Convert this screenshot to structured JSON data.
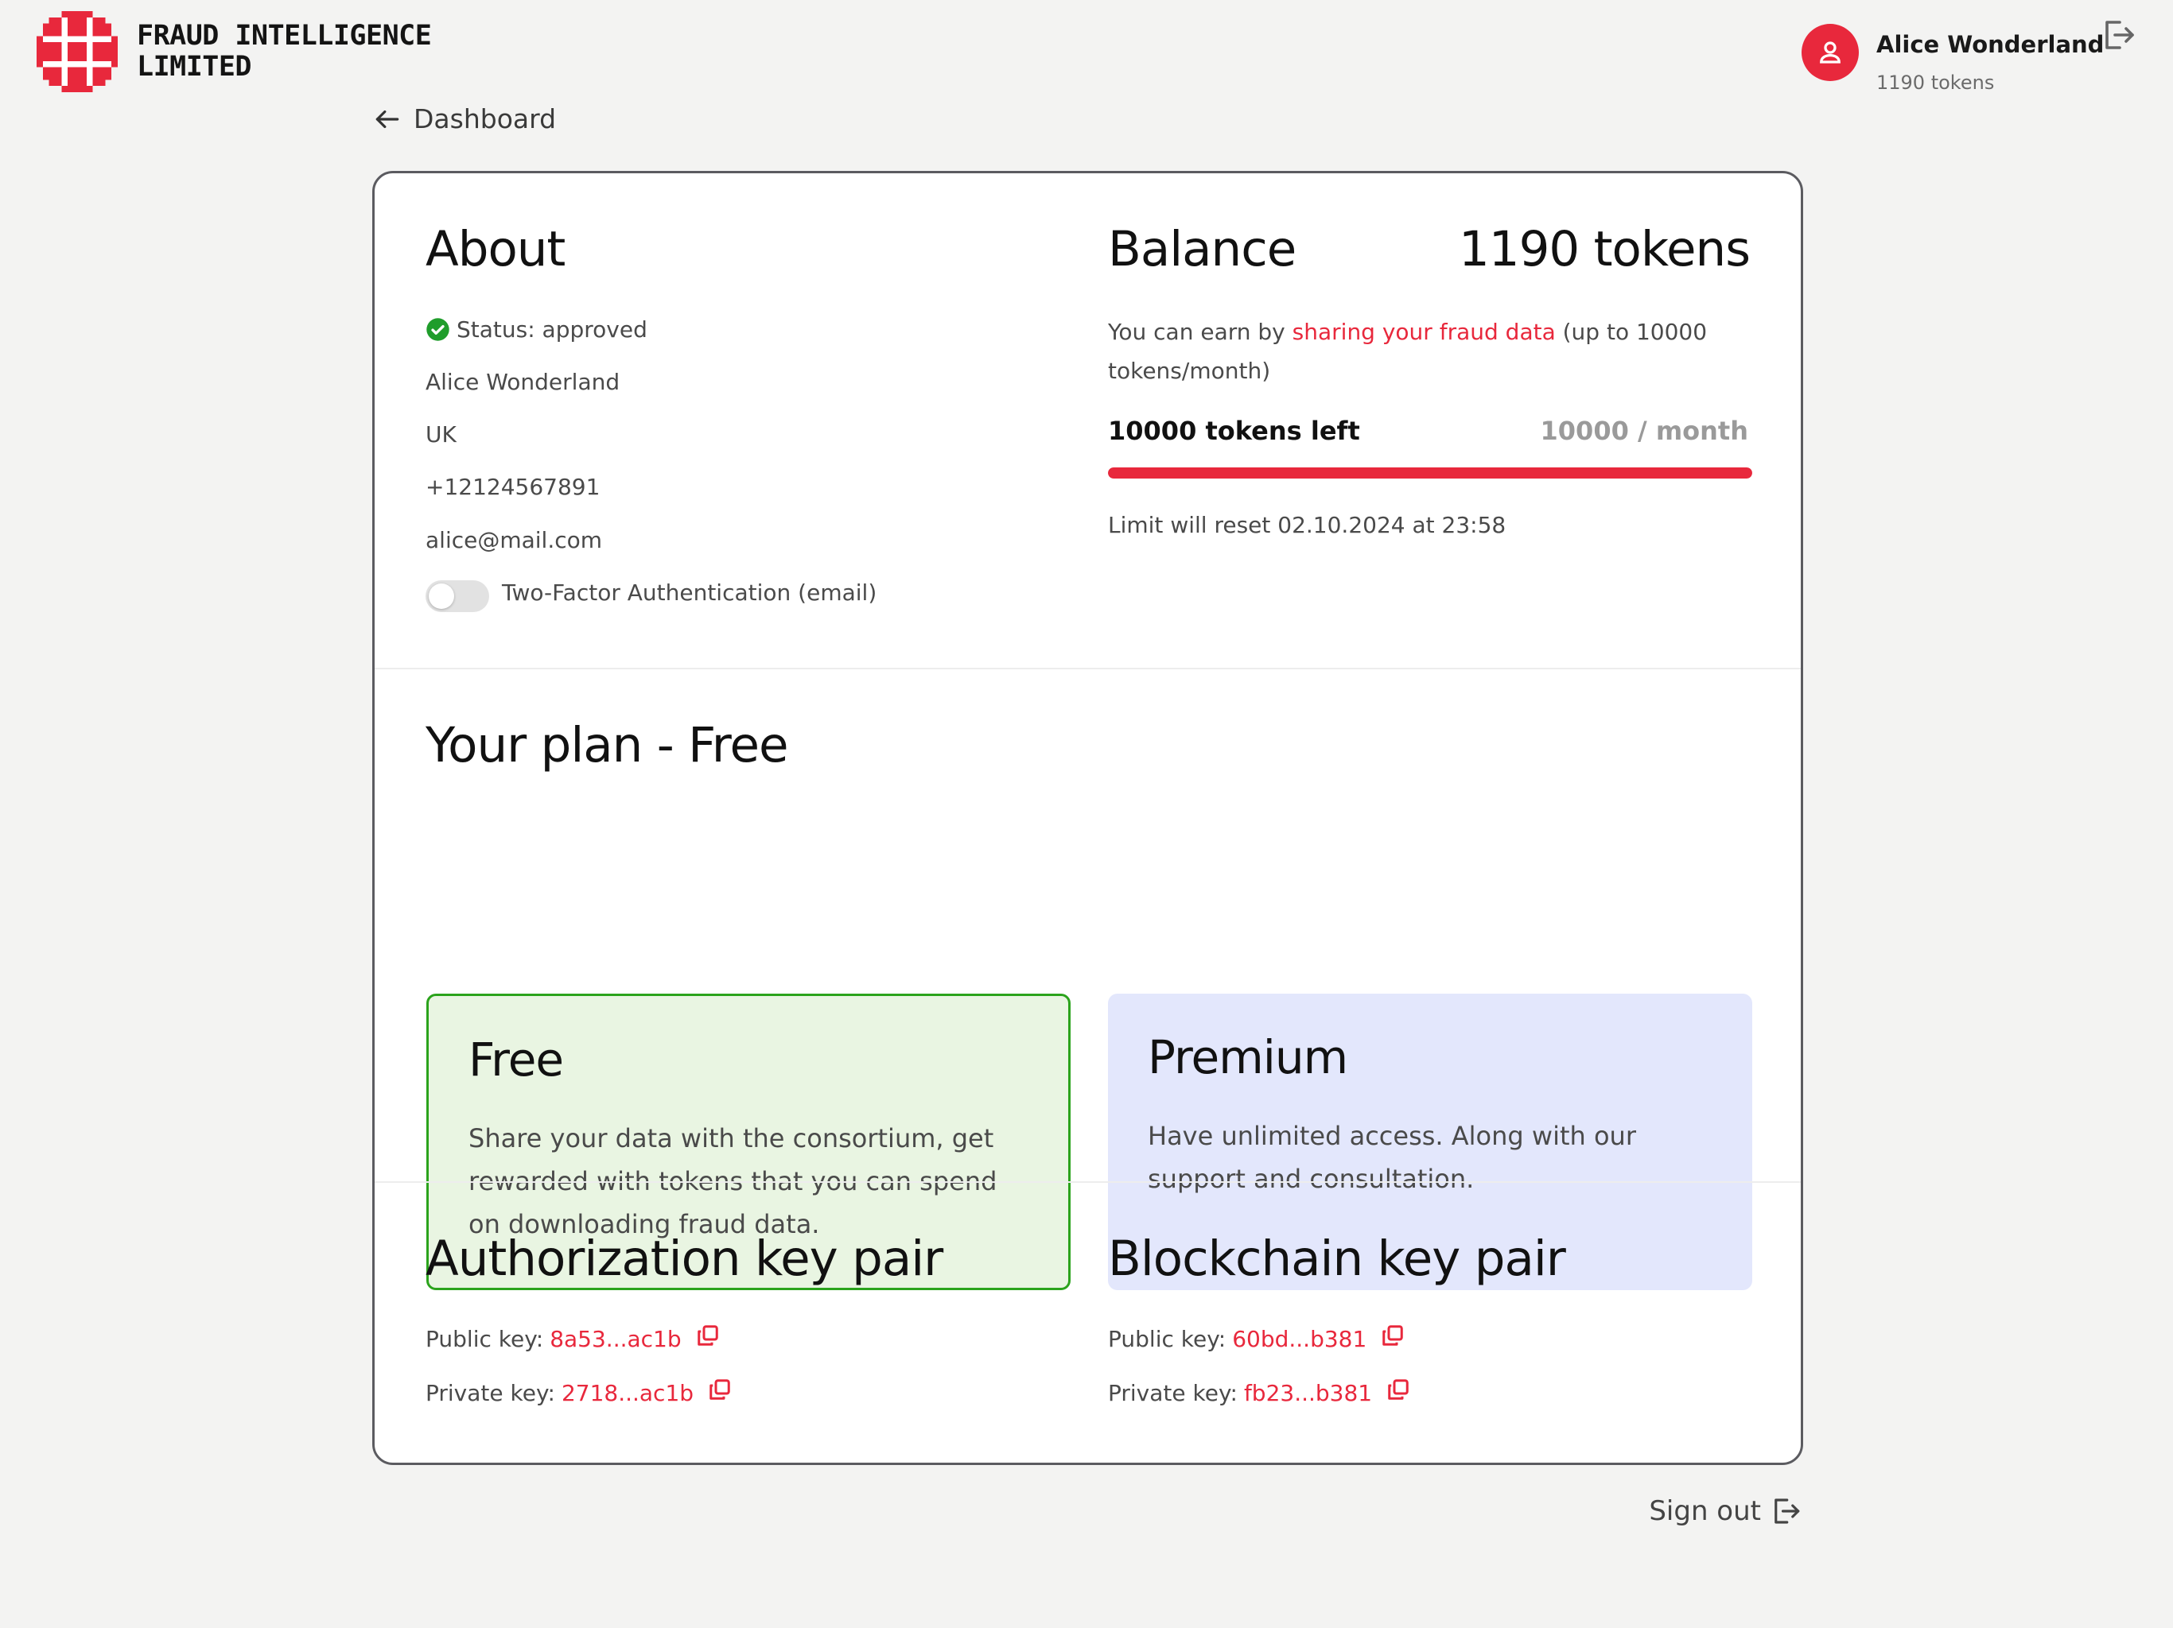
{
  "brand": {
    "line1": "FRAUD INTELLIGENCE",
    "line2": "LIMITED",
    "color": "#e8283c"
  },
  "user": {
    "name": "Alice Wonderland",
    "tokens": "1190 tokens",
    "avatar_icon": "user-icon",
    "signout_icon": "sign-out-icon"
  },
  "nav": {
    "back_label": "Dashboard",
    "back_icon": "arrow-left-icon"
  },
  "about": {
    "title": "About",
    "status": "Status: approved",
    "status_icon": "check-circle-icon",
    "name": "Alice Wonderland",
    "country": "UK",
    "phone": "+12124567891",
    "email": "alice@mail.com",
    "twofa_label": "Two-Factor Authentication (email)",
    "twofa_enabled": false
  },
  "balance": {
    "title": "Balance",
    "tokens": "1190 tokens",
    "earn_prefix": "You can earn by ",
    "earn_link": "sharing your fraud data",
    "earn_suffix": " (up to 10000 tokens/month)",
    "left_label": "10000 tokens left",
    "limit_label": "10000 / month",
    "progress_fraction": 1.0,
    "reset_text": "Limit will reset 02.10.2024 at 23:58"
  },
  "plan": {
    "title": "Your plan - Free",
    "free": {
      "title": "Free",
      "desc": "Share your data with the consortium, get rewarded with tokens that you can spend on downloading fraud data."
    },
    "premium": {
      "title": "Premium",
      "desc": "Have unlimited access. Along with our support and consultation."
    }
  },
  "auth_keys": {
    "title": "Authorization key pair",
    "public_label": "Public key:",
    "public_value": "8a53...ac1b",
    "private_label": "Private key:",
    "private_value": "2718...ac1b"
  },
  "chain_keys": {
    "title": "Blockchain key pair",
    "public_label": "Public key:",
    "public_value": "60bd...b381",
    "private_label": "Private key:",
    "private_value": "fb23...b381"
  },
  "footer": {
    "signout_label": "Sign out",
    "signout_icon": "sign-out-icon"
  },
  "colors": {
    "accent": "#e8283c",
    "approved": "#1f9d2b",
    "free_bg": "#e9f5e2",
    "premium_bg": "#e3e7fc"
  }
}
